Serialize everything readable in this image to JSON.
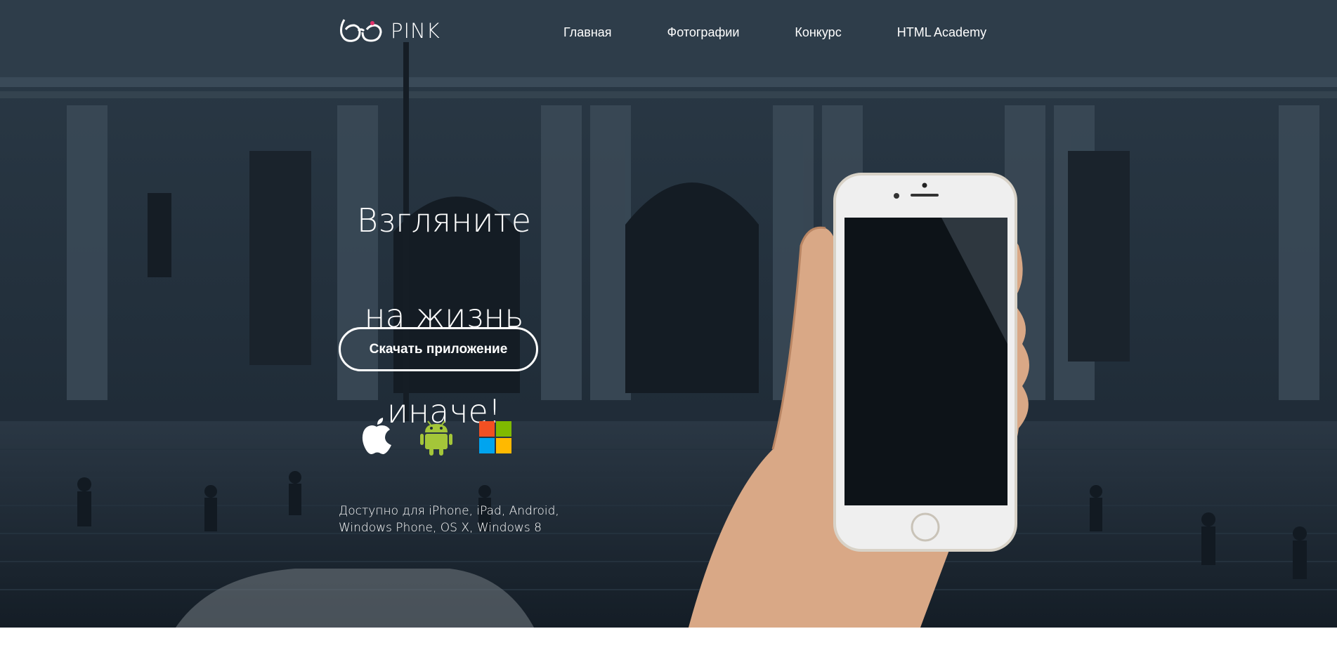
{
  "logo": {
    "text": "PINK"
  },
  "nav": {
    "items": [
      {
        "label": "Главная"
      },
      {
        "label": "Фотографии"
      },
      {
        "label": "Конкурс"
      },
      {
        "label": "HTML Academy"
      }
    ]
  },
  "hero": {
    "title_lines": [
      "Взгляните",
      "на жизнь",
      "иначе!"
    ],
    "download_button": "Скачать приложение",
    "platforms": [
      {
        "icon": "apple-icon"
      },
      {
        "icon": "android-icon"
      },
      {
        "icon": "windows-icon"
      }
    ],
    "availability_lines": [
      "Доступно для iPhone, iPad, Android,",
      "Windows Phone, OS X, Windows 8"
    ]
  },
  "colors": {
    "hero_overlay": "#1d2a36",
    "text": "#ffffff",
    "android_green": "#a4c639",
    "windows_red": "#f25022",
    "windows_green": "#7fba00",
    "windows_blue": "#00a4ef",
    "windows_yellow": "#ffb900"
  }
}
